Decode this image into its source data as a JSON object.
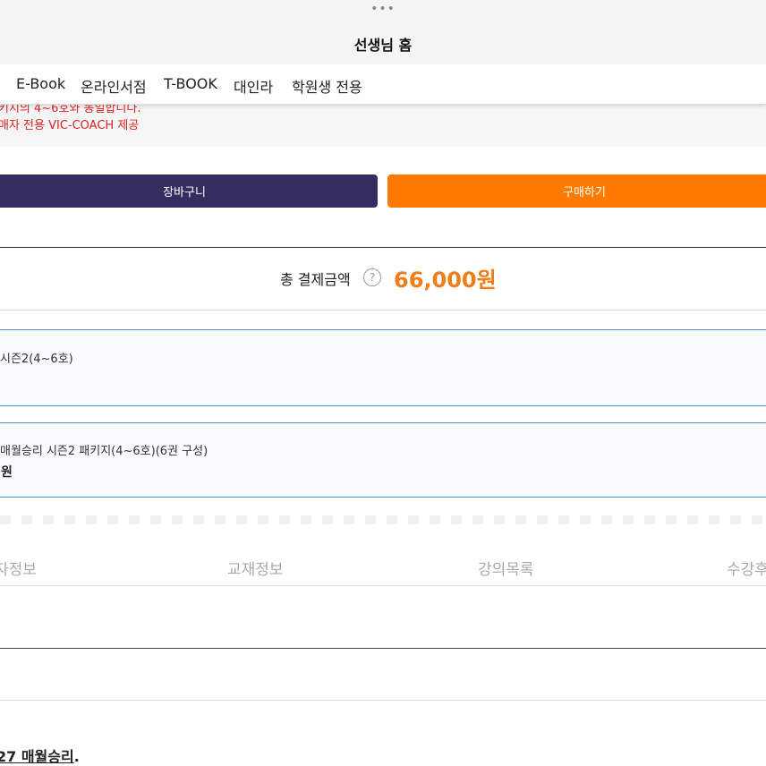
{
  "window": {
    "dots": "•••",
    "title": "선생님 홈"
  },
  "nav": {
    "items": [
      "E-Book",
      "온라인서점",
      "T-BOOK",
      "대인라",
      "학원생 전용"
    ]
  },
  "notice": {
    "line1": "키지의 4~6호와 동일합니다.",
    "line2": "매자 전용 VIC-COACH 제공"
  },
  "actions": {
    "cart_label": "장바구니",
    "buy_label": "구매하기"
  },
  "total": {
    "label": "총 결제금액",
    "help_icon": "?",
    "price": "66,000원"
  },
  "options": {
    "selected_name": "시즌2(4~6호)",
    "item_name": "매월승리 시즌2 패키지(4~6호)(6권 구성)",
    "item_price": "원"
  },
  "tabs": [
    "자정보",
    "교재정보",
    "강의목록",
    "수강후"
  ],
  "footer": {
    "title_underlined": "27 매월승리",
    "title_suffix": "."
  },
  "colors": {
    "cart_button": "#342e60",
    "buy_button": "#ff7a00",
    "price": "#f07c1a",
    "notice_text": "#dd2222",
    "option_border": "#4b8fcf"
  }
}
